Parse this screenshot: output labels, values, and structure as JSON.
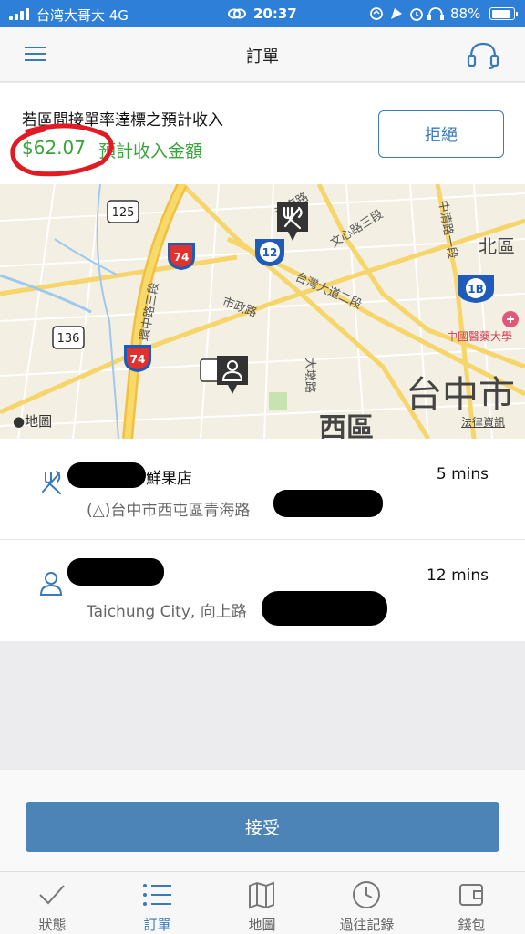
{
  "status_bar": {
    "carrier": "台湾大哥大  4G",
    "time": "20:37",
    "battery": "88%",
    "battery_level": 0.88
  },
  "nav": {
    "title": "訂單",
    "menu_icon": "hamburger-menu-icon",
    "support_icon": "headset-icon"
  },
  "earnings": {
    "label": "若區間接單率達標之預計收入",
    "amount": "$62.07",
    "amount_label": "預計收入金額",
    "reject_label": "拒絕",
    "amount_color": "#3aa33a"
  },
  "map": {
    "city_label": "台中市",
    "district_label": "西區",
    "north_label": "北區",
    "hospital_label": "中國醫藥大學",
    "legal_label": "法律資訊",
    "maps_label": "地圖",
    "road_labels": [
      "文心路三段",
      "台灣大道二段",
      "市政路",
      "大墩路",
      "中清路一段",
      "河南路",
      "環中路三段"
    ],
    "shields": [
      "125",
      "74",
      "12",
      "136",
      "74",
      "12",
      "1B"
    ]
  },
  "pickup": {
    "name": "鮮果店",
    "address": "(△)台中市西屯區青海路",
    "eta": "5 mins"
  },
  "dropoff": {
    "name": "",
    "address": "Taichung City, 向上路",
    "eta": "12 mins"
  },
  "accept_label": "接受",
  "tabs": [
    {
      "label": "狀態",
      "icon": "checkmark-icon"
    },
    {
      "label": "訂單",
      "icon": "list-icon"
    },
    {
      "label": "地圖",
      "icon": "map-icon"
    },
    {
      "label": "過往記錄",
      "icon": "clock-icon"
    },
    {
      "label": "錢包",
      "icon": "wallet-icon"
    }
  ],
  "colors": {
    "status_bar": "#2d7fd8",
    "accent": "#3a7ab8",
    "accept_button": "#4d84b8",
    "earnings_green": "#3aa33a",
    "annotation_red": "#e01b24"
  }
}
